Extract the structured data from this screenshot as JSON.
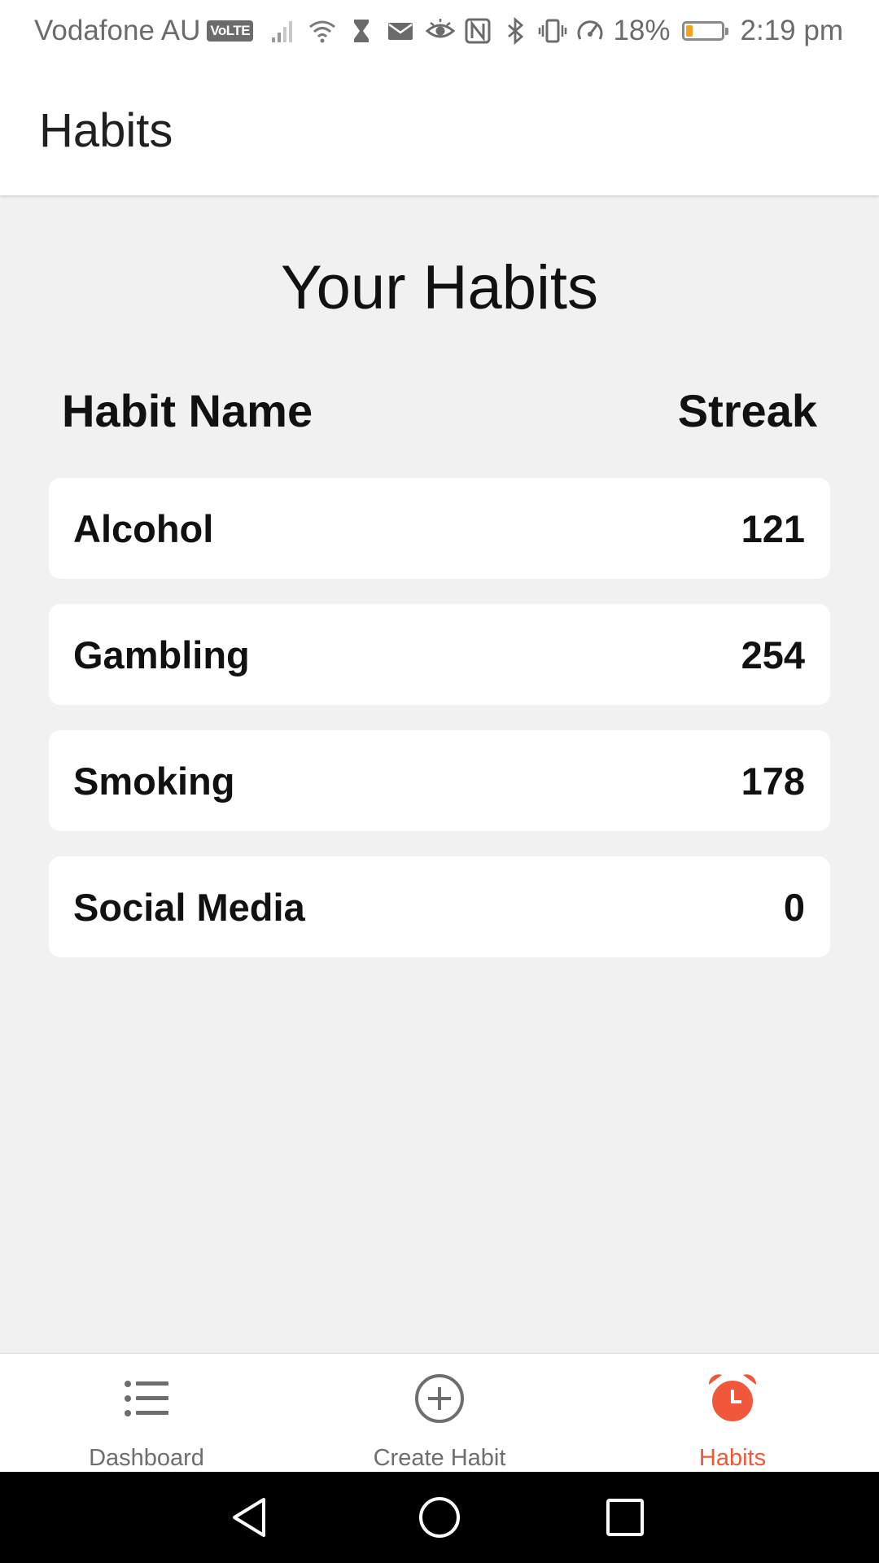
{
  "status_bar": {
    "carrier": "Vodafone AU",
    "volte_badge": "VoLTE",
    "battery_percent": "18%",
    "battery_level": 0.18,
    "time": "2:19 pm",
    "icons_left": [
      "signal-icon",
      "wifi-icon",
      "hourglass-icon",
      "mail-icon"
    ],
    "icons_right": [
      "eye-icon",
      "nfc-icon",
      "bluetooth-icon",
      "vibrate-icon",
      "speedometer-icon"
    ]
  },
  "app_bar": {
    "title": "Habits"
  },
  "main": {
    "heading": "Your Habits",
    "columns": {
      "name": "Habit Name",
      "streak": "Streak"
    },
    "habits": [
      {
        "name": "Alcohol",
        "streak": "121"
      },
      {
        "name": "Gambling",
        "streak": "254"
      },
      {
        "name": "Smoking",
        "streak": "178"
      },
      {
        "name": "Social Media",
        "streak": "0"
      }
    ]
  },
  "bottom_nav": {
    "items": [
      {
        "label": "Dashboard",
        "icon": "list-icon",
        "active": false
      },
      {
        "label": "Create Habit",
        "icon": "add-circle-icon",
        "active": false
      },
      {
        "label": "Habits",
        "icon": "alarm-clock-icon",
        "active": true
      }
    ]
  },
  "colors": {
    "accent": "#f0573b",
    "background": "#f1f1f1",
    "card": "#ffffff",
    "nav_inactive": "#6e6e6e"
  },
  "system_nav": {
    "buttons": [
      "back-icon",
      "home-icon",
      "recents-icon"
    ]
  }
}
